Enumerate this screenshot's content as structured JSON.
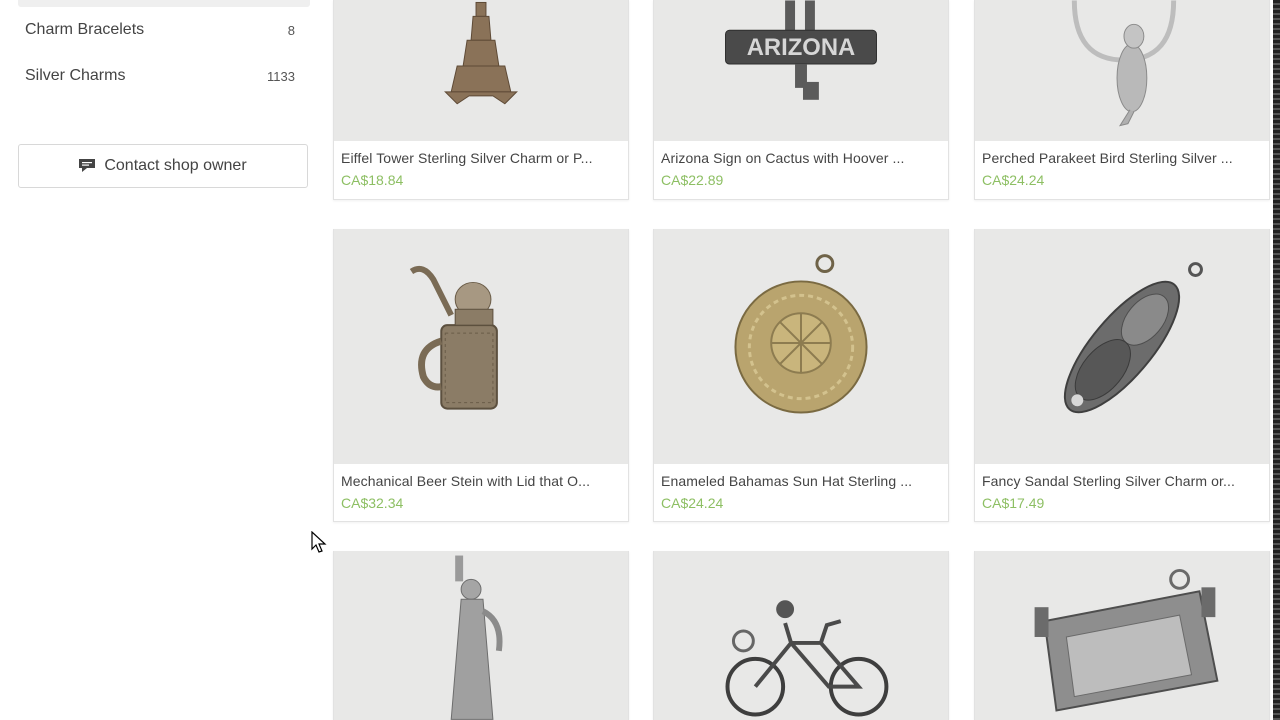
{
  "sidebar": {
    "items": [
      {
        "label": "Charm Bracelets",
        "count": "8"
      },
      {
        "label": "Silver Charms",
        "count": "1133"
      }
    ],
    "contact_label": "Contact shop owner",
    "contact_icon": "message-icon"
  },
  "listings": [
    {
      "title": "Eiffel Tower Sterling Silver Charm or P...",
      "price": "CA$18.84",
      "icon": "eiffel-tower-charm-image"
    },
    {
      "title": "Arizona Sign on Cactus with Hoover ...",
      "price": "CA$22.89",
      "icon": "arizona-sign-charm-image",
      "sign_text": "ARIZONA"
    },
    {
      "title": "Perched Parakeet Bird Sterling Silver ...",
      "price": "CA$24.24",
      "icon": "parakeet-charm-image"
    },
    {
      "title": "Mechanical Beer Stein with Lid that O...",
      "price": "CA$32.34",
      "icon": "beer-stein-charm-image"
    },
    {
      "title": "Enameled Bahamas Sun Hat Sterling ...",
      "price": "CA$24.24",
      "icon": "sun-hat-charm-image"
    },
    {
      "title": "Fancy Sandal Sterling Silver Charm or...",
      "price": "CA$17.49",
      "icon": "sandal-charm-image"
    },
    {
      "title": "",
      "price": "",
      "icon": "statue-of-liberty-charm-image"
    },
    {
      "title": "",
      "price": "",
      "icon": "bicycle-charm-image"
    },
    {
      "title": "",
      "price": "",
      "icon": "cradle-charm-image"
    }
  ],
  "colors": {
    "price": "#8dbf63",
    "thumb_bg": "#e8e8e7",
    "border": "#e2e2e2"
  }
}
